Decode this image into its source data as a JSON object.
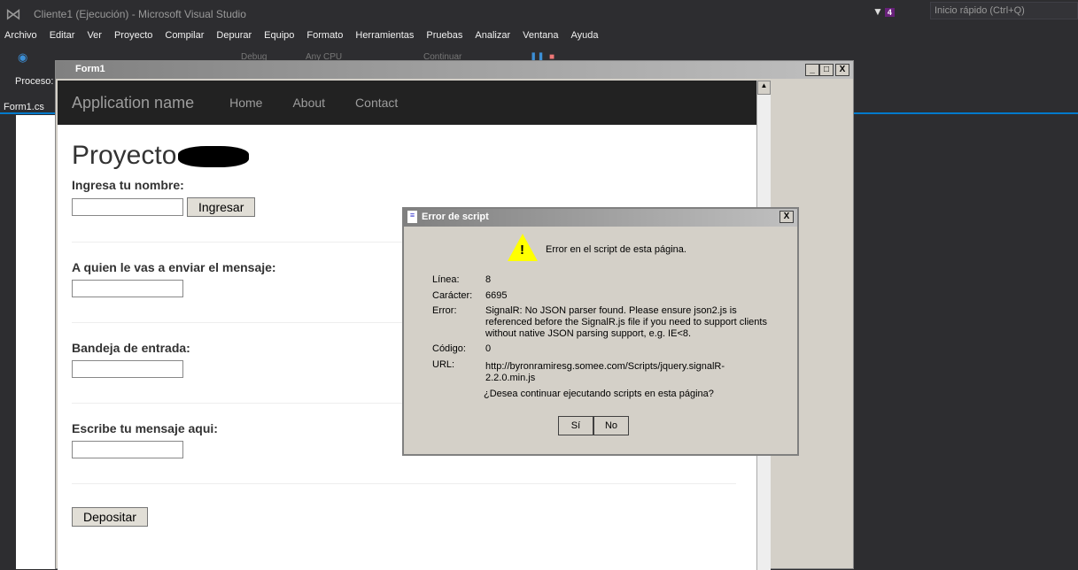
{
  "vs": {
    "title": "Cliente1 (Ejecución) - Microsoft Visual Studio",
    "quick_search_placeholder": "Inicio rápido (Ctrl+Q)",
    "notification_count": "4",
    "menu": [
      "Archivo",
      "Editar",
      "Ver",
      "Proyecto",
      "Compilar",
      "Depurar",
      "Equipo",
      "Formato",
      "Herramientas",
      "Pruebas",
      "Analizar",
      "Ventana",
      "Ayuda"
    ],
    "toolbar": {
      "config": "Debug",
      "platform": "Any CPU",
      "continue": "Continuar"
    },
    "process_label": "Proceso:",
    "doc_tab": "Form1.cs",
    "accent": "#007acc"
  },
  "form": {
    "title": "Form1",
    "min": "_",
    "max": "□",
    "close": "X"
  },
  "web": {
    "brand": "Application name",
    "nav": [
      "Home",
      "About",
      "Contact"
    ],
    "heading": "Proyecto",
    "fields": [
      {
        "label": "Ingresa tu nombre:",
        "button": "Ingresar"
      },
      {
        "label": "A quien le vas a enviar el mensaje:"
      },
      {
        "label": "Bandeja de entrada:"
      },
      {
        "label": "Escribe tu mensaje aqui:"
      }
    ],
    "submit": "Depositar"
  },
  "dialog": {
    "title": "Error de script",
    "message": "Error en el script de esta página.",
    "rows": [
      {
        "k": "Línea:",
        "v": "8"
      },
      {
        "k": "Carácter:",
        "v": "6695"
      },
      {
        "k": "Error:",
        "v": "SignalR: No JSON parser found. Please ensure json2.js is referenced before the SignalR.js file if you need to support clients without native JSON parsing support, e.g. IE<8."
      },
      {
        "k": "Código:",
        "v": "0"
      },
      {
        "k": "URL:",
        "v": "http://byronramiresg.somee.com/Scripts/jquery.signalR-2.2.0.min.js"
      }
    ],
    "question": "¿Desea continuar ejecutando scripts en esta página?",
    "yes": "Sí",
    "no": "No",
    "close": "X"
  }
}
